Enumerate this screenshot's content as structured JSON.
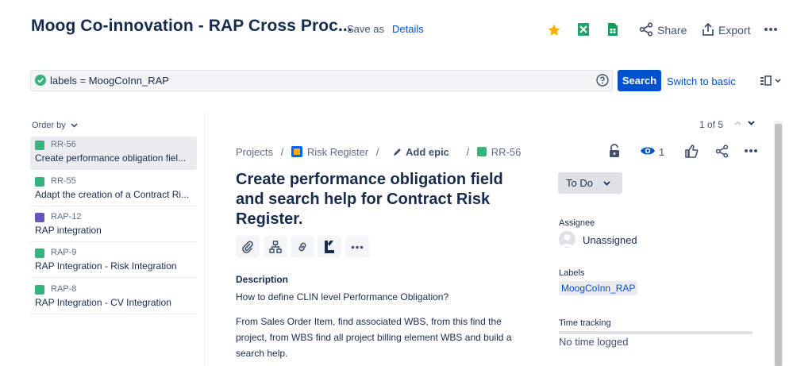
{
  "header": {
    "title": "Moog Co-innovation - RAP Cross Proc...",
    "save_as": "Save as",
    "details": "Details",
    "share": "Share",
    "export": "Export"
  },
  "search": {
    "query": "labels = MoogCoInn_RAP",
    "button": "Search",
    "switch": "Switch to basic"
  },
  "list": {
    "order_by": "Order by",
    "items": [
      {
        "key": "RR-56",
        "summary": "Create performance obligation fiel...",
        "type": "story"
      },
      {
        "key": "RR-55",
        "summary": "Adapt the creation of a Contract Ri...",
        "type": "story"
      },
      {
        "key": "RAP-12",
        "summary": "RAP integration",
        "type": "epic"
      },
      {
        "key": "RAP-9",
        "summary": "RAP Integration - Risk Integration",
        "type": "story"
      },
      {
        "key": "RAP-8",
        "summary": "RAP Integration - CV Integration",
        "type": "story"
      }
    ]
  },
  "detail": {
    "pager": "1 of 5",
    "breadcrumb": {
      "projects": "Projects",
      "project": "Risk Register",
      "add_epic": "Add epic",
      "key": "RR-56"
    },
    "watchers": "1",
    "title": "Create performance obligation field and search help for Contract Risk Register.",
    "description_heading": "Description",
    "description_p1": "How to define CLIN level Performance Obligation?",
    "description_p2": "From Sales Order Item, find associated WBS, from this find the project, from WBS find all project billing element WBS and build a search help.",
    "status": "To Do",
    "assignee_label": "Assignee",
    "assignee": "Unassigned",
    "labels_label": "Labels",
    "label": "MoogCoInn_RAP",
    "time_tracking_label": "Time tracking",
    "time_tracking": "No time logged"
  },
  "colors": {
    "primary": "#0052cc",
    "story": "#36b37e",
    "epic": "#6554c0",
    "star": "#f6b100",
    "excel": "#21a366"
  }
}
